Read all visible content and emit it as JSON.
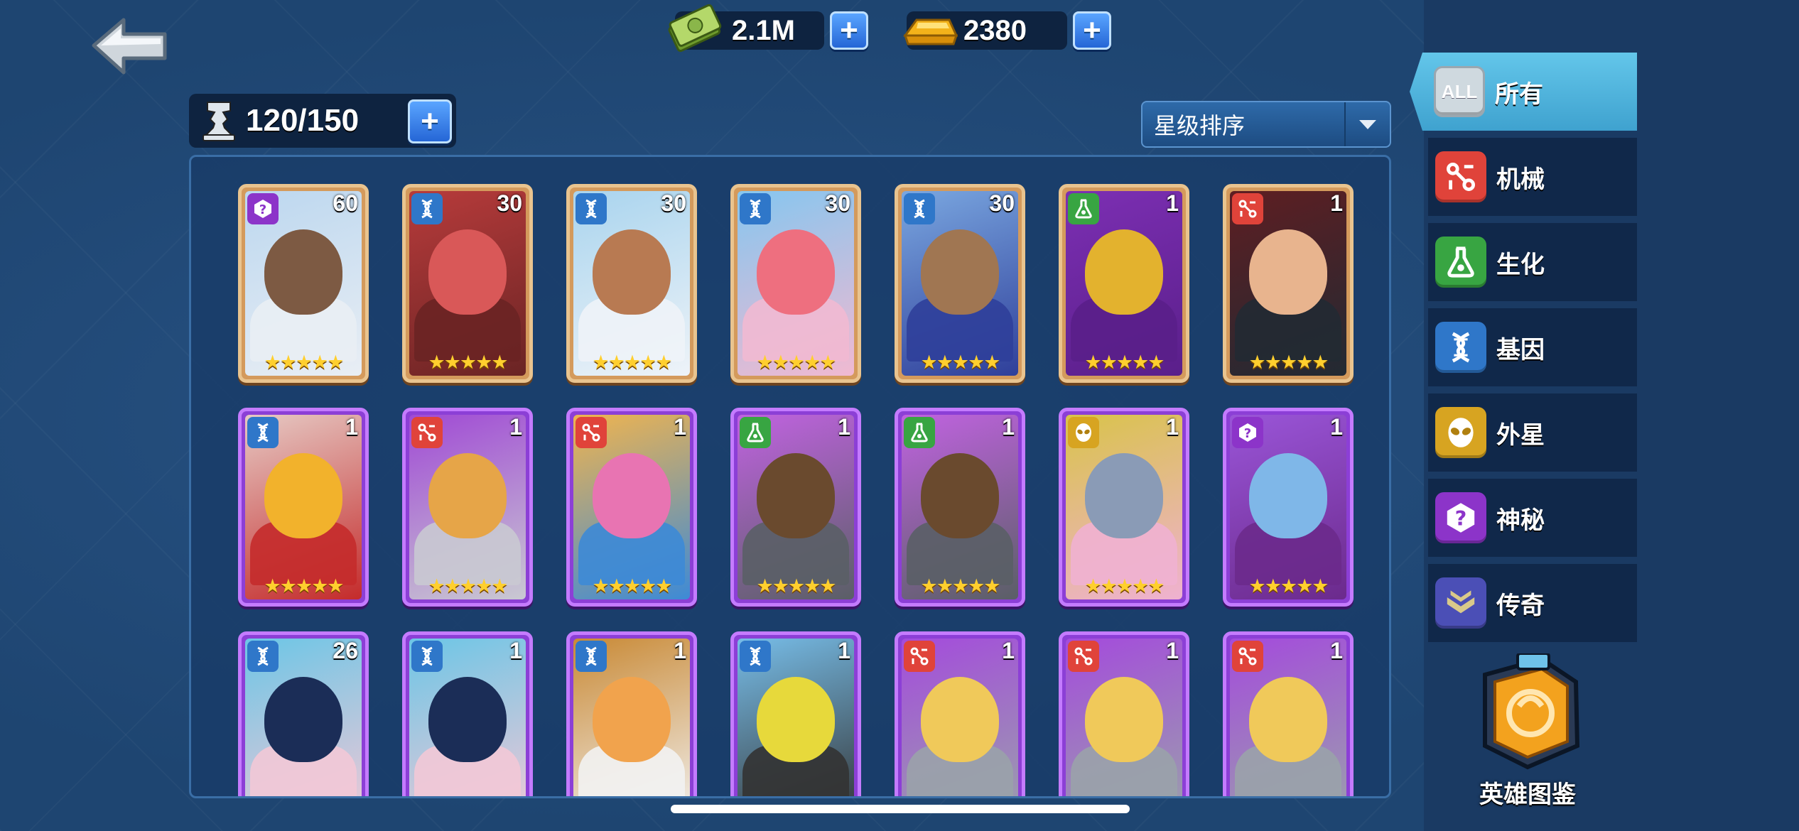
{
  "header": {
    "cash": "2.1M",
    "gold": "2380",
    "capacity": "120/150",
    "sort_label": "星级排序"
  },
  "colors": {
    "mech": "#e0433a",
    "bio": "#38a542",
    "gene": "#2f77c9",
    "alien": "#d7a421",
    "mystic": "#8c34c9",
    "legend": "#4b4fb6",
    "active_tab": "#4bb3dd"
  },
  "sidebar": {
    "items": [
      {
        "label": "所有",
        "icon": "all-icon",
        "icon_text": "ALL",
        "active": true
      },
      {
        "label": "机械",
        "icon": "mech-icon",
        "color": "#e0433a"
      },
      {
        "label": "生化",
        "icon": "bio-flask-icon",
        "color": "#38a542"
      },
      {
        "label": "基因",
        "icon": "dna-icon",
        "color": "#2f77c9"
      },
      {
        "label": "外星",
        "icon": "alien-icon",
        "color": "#d7a421"
      },
      {
        "label": "神秘",
        "icon": "mystic-icon",
        "color": "#8c34c9"
      },
      {
        "label": "传奇",
        "icon": "legend-chevron-icon",
        "color": "#4b4fb6"
      }
    ],
    "codex_label": "英雄图鉴"
  },
  "heroes": [
    {
      "level": "60",
      "faction": "mystic",
      "rarity": "gold",
      "stars": "★★★★★"
    },
    {
      "level": "30",
      "faction": "gene",
      "rarity": "gold",
      "stars": "★★★★★"
    },
    {
      "level": "30",
      "faction": "gene",
      "rarity": "gold",
      "stars": "★★★★★"
    },
    {
      "level": "30",
      "faction": "gene",
      "rarity": "gold",
      "stars": "★★★★★"
    },
    {
      "level": "30",
      "faction": "gene",
      "rarity": "gold",
      "stars": "★★★★★"
    },
    {
      "level": "1",
      "faction": "bio",
      "rarity": "gold",
      "stars": "★★★★★"
    },
    {
      "level": "1",
      "faction": "mech",
      "rarity": "gold",
      "stars": "★★★★★"
    },
    {
      "level": "1",
      "faction": "gene",
      "rarity": "purple",
      "stars": "★★★★★"
    },
    {
      "level": "1",
      "faction": "mech",
      "rarity": "purple",
      "stars": "★★★★★"
    },
    {
      "level": "1",
      "faction": "mech",
      "rarity": "purple",
      "stars": "★★★★★"
    },
    {
      "level": "1",
      "faction": "bio",
      "rarity": "purple",
      "stars": "★★★★★"
    },
    {
      "level": "1",
      "faction": "bio",
      "rarity": "purple",
      "stars": "★★★★★"
    },
    {
      "level": "1",
      "faction": "alien",
      "rarity": "purple",
      "stars": "★★★★★"
    },
    {
      "level": "1",
      "faction": "mystic",
      "rarity": "purple",
      "stars": "★★★★★"
    },
    {
      "level": "26",
      "faction": "gene",
      "rarity": "purple",
      "stars": ""
    },
    {
      "level": "1",
      "faction": "gene",
      "rarity": "purple",
      "stars": ""
    },
    {
      "level": "1",
      "faction": "gene",
      "rarity": "purple",
      "stars": ""
    },
    {
      "level": "1",
      "faction": "gene",
      "rarity": "purple",
      "stars": ""
    },
    {
      "level": "1",
      "faction": "mech",
      "rarity": "purple",
      "stars": ""
    },
    {
      "level": "1",
      "faction": "mech",
      "rarity": "purple",
      "stars": ""
    },
    {
      "level": "1",
      "faction": "mech",
      "rarity": "purple",
      "stars": ""
    }
  ]
}
